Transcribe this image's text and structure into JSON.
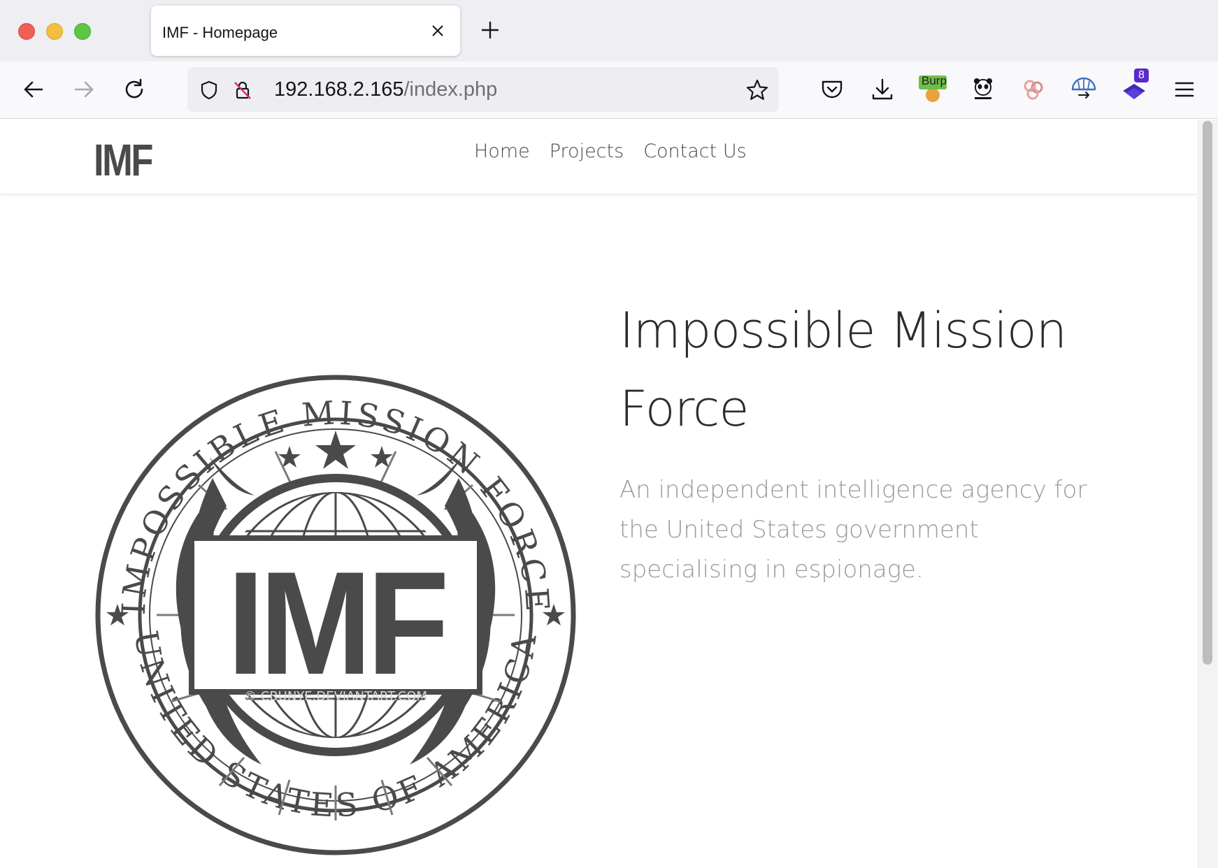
{
  "browser": {
    "tab": {
      "title": "IMF - Homepage"
    },
    "url": {
      "host": "192.168.2.165",
      "path": "/index.php"
    },
    "toolbar": {
      "burp_label": "Burp",
      "notification_count": "8"
    }
  },
  "site": {
    "logo_text": "IMF",
    "nav": [
      {
        "label": "Home"
      },
      {
        "label": "Projects"
      },
      {
        "label": "Contact Us"
      }
    ],
    "hero": {
      "title": "Impossible Mission Force",
      "subtitle": "An independent intelligence agency for the United States government specialising in espionage."
    },
    "emblem": {
      "top_text": "IMPOSSIBLE MISSION FORCE",
      "bottom_text": "UNITED STATES OF AMERICA",
      "center_text": "IMF",
      "watermark": "© CBUNYE.DEVIANTART.COM"
    }
  },
  "colors": {
    "text_dark": "#2c2c2c",
    "text_muted": "#9a9a9a",
    "emblem": "#4a4a4a",
    "chrome_bg": "#efeef3"
  }
}
